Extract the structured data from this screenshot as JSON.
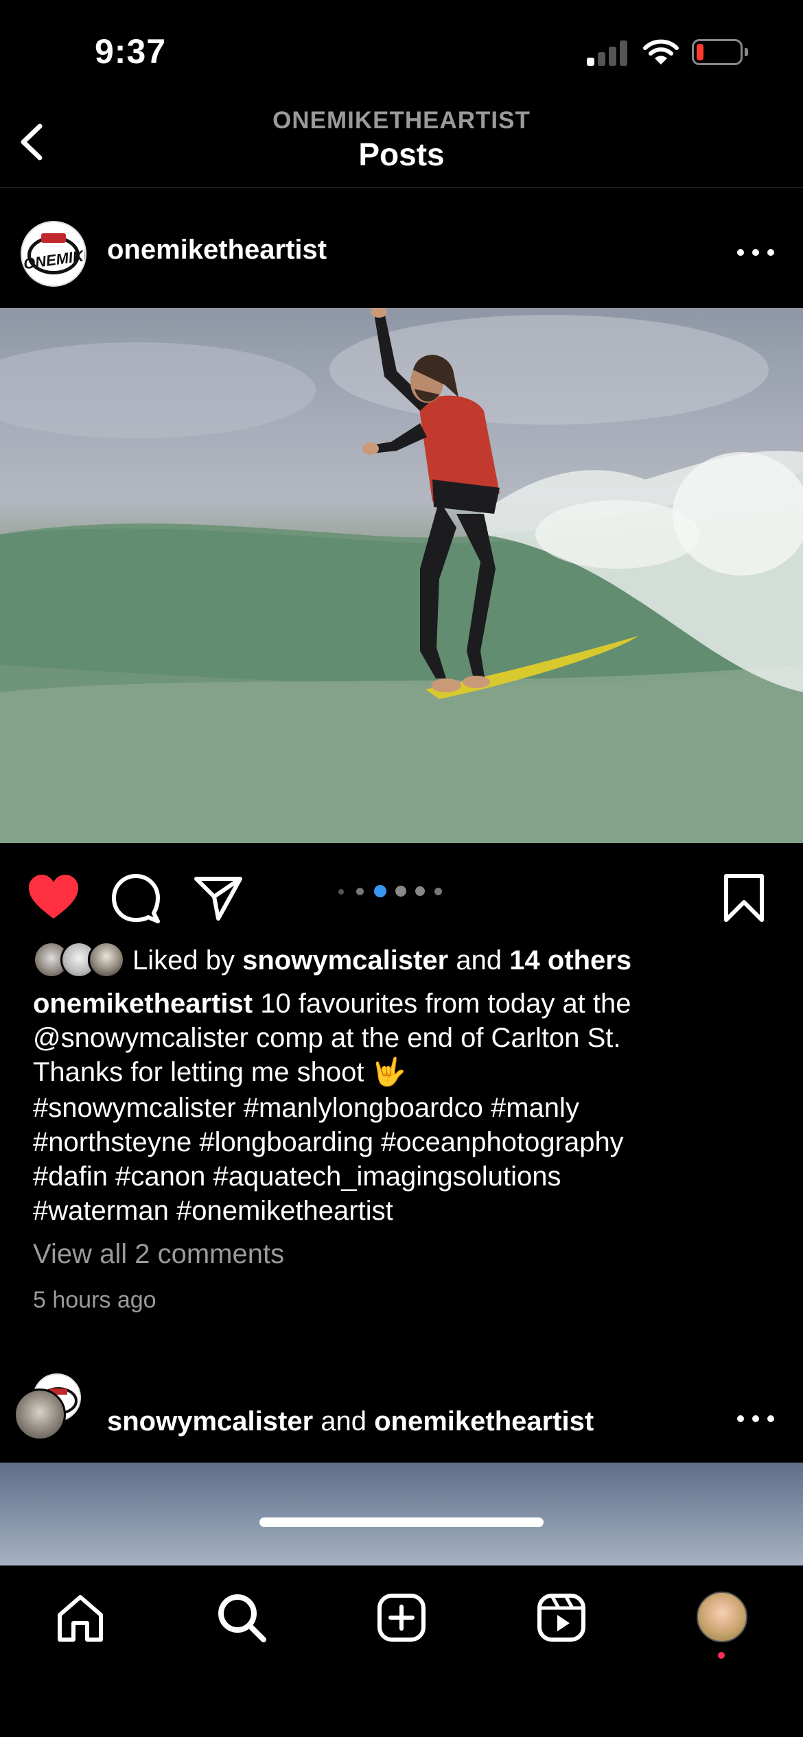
{
  "status_bar": {
    "time": "9:37"
  },
  "nav": {
    "subtitle": "ONEMIKETHEARTIST",
    "title": "Posts"
  },
  "post": {
    "username": "onemiketheartist",
    "avatar_text": "ONEMIKE",
    "carousel": {
      "count": 6,
      "active_index": 2
    },
    "likes": {
      "prefix": "Liked by ",
      "user": "snowymcalister",
      "middle": " and ",
      "others": "14 others"
    },
    "caption": {
      "username": "onemiketheartist",
      "line1": " 10 favourites from today at the",
      "line2": "@snowymcalister comp at the end of Carlton St.",
      "line3": "Thanks for letting me shoot 🤟",
      "hashtags1": "#snowymcalister #manlylongboardco #manly",
      "hashtags2": "#northsteyne #longboarding #oceanphotography",
      "hashtags3": "#dafin #canon #aquatech_imagingsolutions",
      "hashtags4": "#waterman #onemiketheartist"
    },
    "view_comments": "View all 2 comments",
    "time_ago": "5 hours ago"
  },
  "post2": {
    "user1": "snowymcalister",
    "joiner": " and ",
    "user2": "onemiketheartist"
  },
  "colors": {
    "accent_blue": "#3897f0",
    "like_red": "#ff3040",
    "muted_text": "#9a9a9a"
  },
  "tabs": [
    "home-icon",
    "search-icon",
    "create-icon",
    "reels-icon",
    "profile-avatar"
  ]
}
